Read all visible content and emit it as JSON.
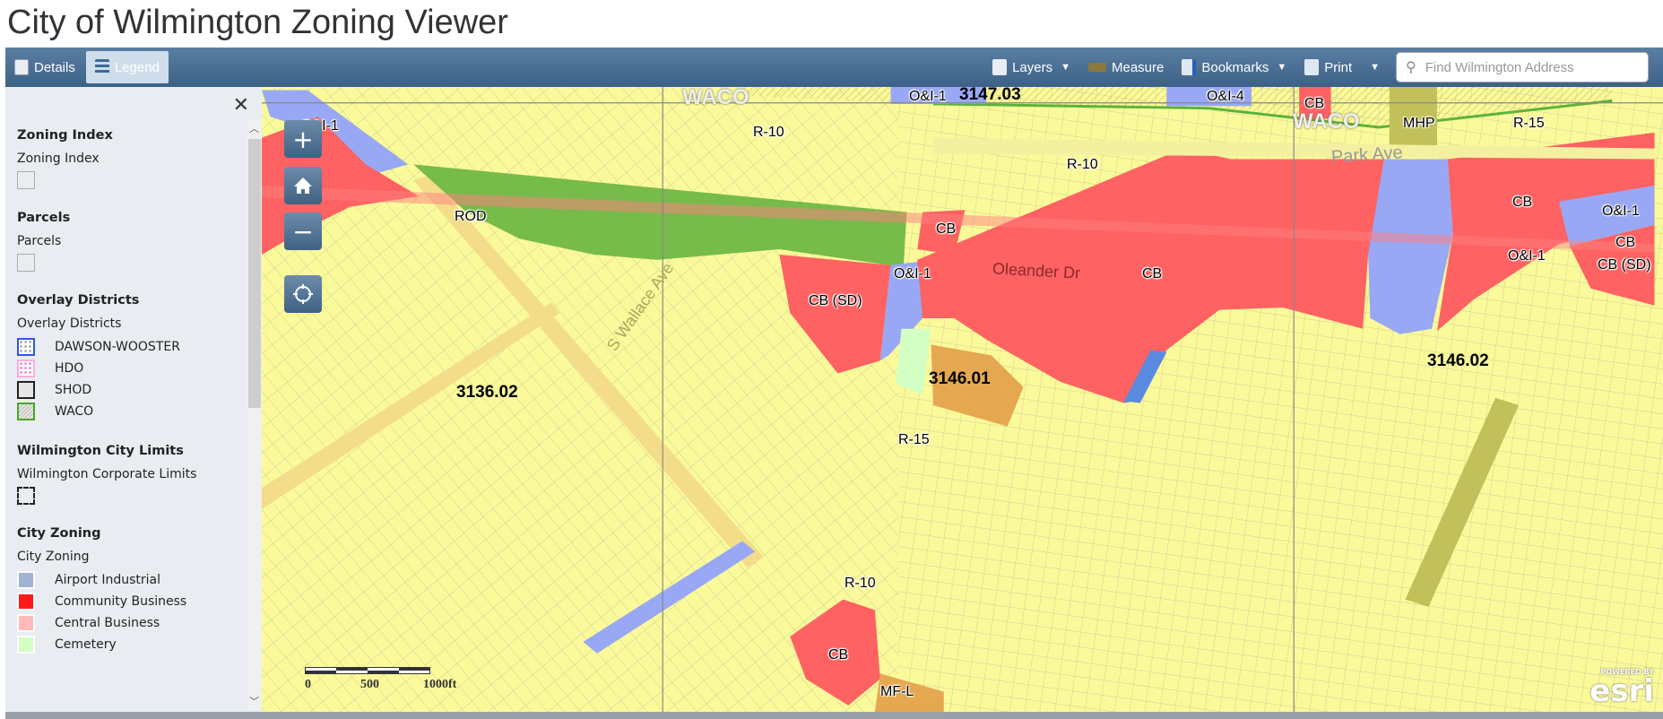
{
  "app": {
    "title": "City of Wilmington Zoning Viewer"
  },
  "toolbar": {
    "details": "Details",
    "legend": "Legend",
    "layers": "Layers",
    "measure": "Measure",
    "bookmarks": "Bookmarks",
    "print": "Print",
    "search_placeholder": "Find Wilmington Address"
  },
  "legend": {
    "groups": [
      {
        "title": "Zoning Index",
        "sub": "Zoning Index"
      },
      {
        "title": "Parcels",
        "sub": "Parcels"
      },
      {
        "title": "Overlay Districts",
        "sub": "Overlay Districts",
        "items": [
          "DAWSON-WOOSTER",
          "HDO",
          "SHOD",
          "WACO"
        ]
      },
      {
        "title": "Wilmington City Limits",
        "sub": "Wilmington Corporate Limits"
      },
      {
        "title": "City Zoning",
        "sub": "City Zoning",
        "items": [
          "Airport Industrial",
          "Community Business",
          "Central Business",
          "Cemetery"
        ]
      }
    ],
    "colors": {
      "airport_industrial": "#a0b4d2",
      "community_business": "#ff1a1a",
      "central_business": "#ffbbbb",
      "cemetery": "#d4ffc4"
    }
  },
  "map": {
    "labels": [
      "WACO",
      "O&I-1",
      "3147.03",
      "O&I-4",
      "CB",
      "WACO",
      "MHP",
      "R-15",
      "R-10",
      "R-10",
      "O&I-1",
      "B",
      "ROD",
      "CB",
      "O&I-1",
      "CB (SD)",
      "O&I-1",
      "Oleander Dr",
      "CB",
      "CB",
      "O&I-1",
      "CB",
      "CB (SD)",
      "3136.02",
      "3146.01",
      "3146.02",
      "R-15",
      "R-10",
      "CB",
      "MF-L",
      "Park Ave",
      "S Wallace Ave"
    ],
    "scale": {
      "labels": [
        "0",
        "500",
        "1000ft"
      ]
    },
    "attribution": {
      "powered": "POWERED BY",
      "brand": "esri"
    },
    "colors": {
      "residential": "#fbfa9a",
      "business": "#ff6262",
      "office": "#98a8f4",
      "rod": "#77bb4a",
      "orange": "#e5a850",
      "olive": "#c2c05a"
    }
  }
}
